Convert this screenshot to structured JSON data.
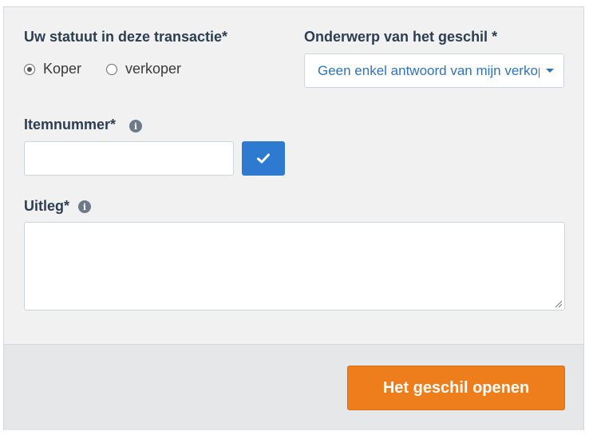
{
  "form": {
    "status": {
      "label": "Uw statuut in deze transactie*",
      "options": [
        {
          "label": "Koper",
          "checked": true
        },
        {
          "label": "verkoper",
          "checked": false
        }
      ]
    },
    "subject": {
      "label": "Onderwerp van het geschil *",
      "selected": "Geen enkel antwoord van mijn verkoper"
    },
    "item_number": {
      "label": "Itemnummer*",
      "value": "",
      "info_icon": "info-icon"
    },
    "explanation": {
      "label": "Uitleg*",
      "value": "",
      "info_icon": "info-icon"
    },
    "confirm_icon": "checkmark-icon"
  },
  "footer": {
    "submit_label": "Het geschil openen"
  },
  "colors": {
    "accent_blue": "#2d7ad0",
    "submit_orange": "#ee7e1b",
    "label_text": "#2c3e50"
  }
}
